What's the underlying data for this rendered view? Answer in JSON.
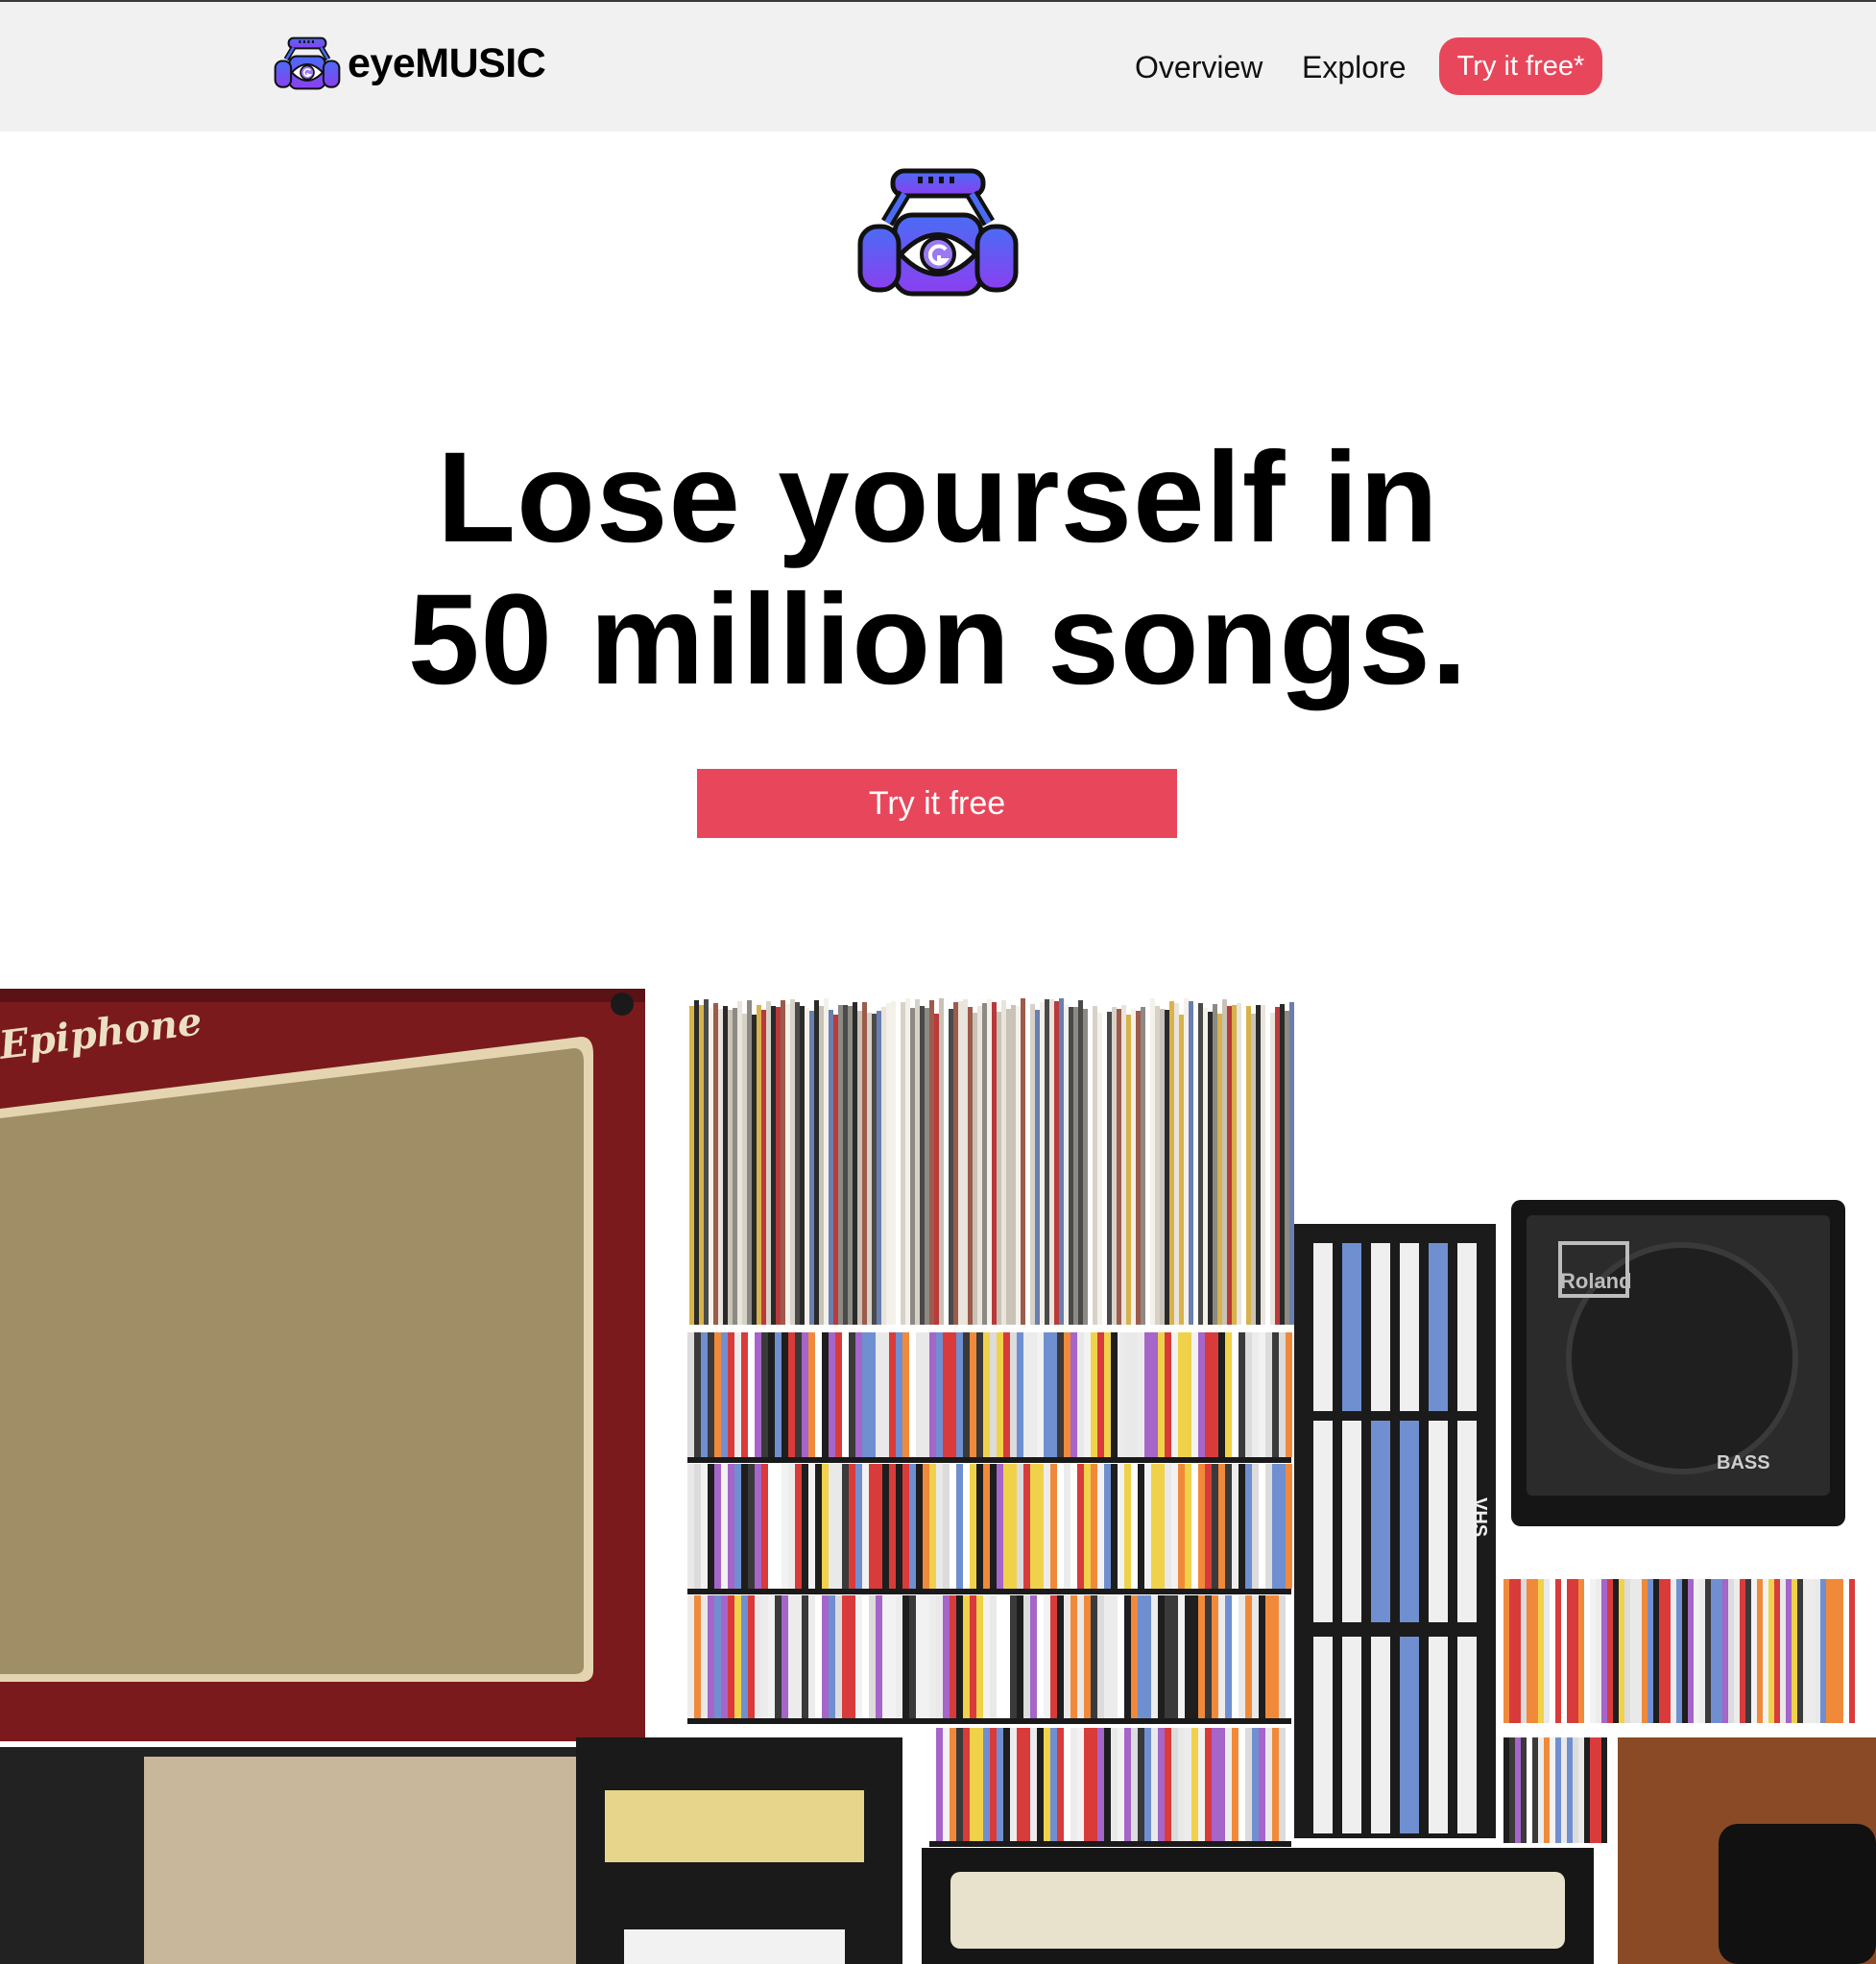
{
  "brand": {
    "name": "eyeMUSIC",
    "logo_icon": "headphones-eye-icon"
  },
  "nav": {
    "items": [
      {
        "label": "Overview"
      },
      {
        "label": "Explore"
      }
    ],
    "cta_label": "Try it free*"
  },
  "hero": {
    "logo_icon": "headphones-eye-icon",
    "headline_line1": "Lose yourself in",
    "headline_line2": "50 million songs.",
    "cta_label": "Try it free",
    "image": {
      "subject": "music-gear-collage",
      "text": {
        "amp_brand": "Epiphone",
        "speaker_brand": "Roland",
        "speaker_badge": "BASS",
        "vhs_label": "VHS"
      }
    }
  },
  "colors": {
    "accent": "#e8475b",
    "nav_bg": "#f1f1f1",
    "logo_blue": "#4a6cf5",
    "logo_purple": "#8b3ff0"
  }
}
